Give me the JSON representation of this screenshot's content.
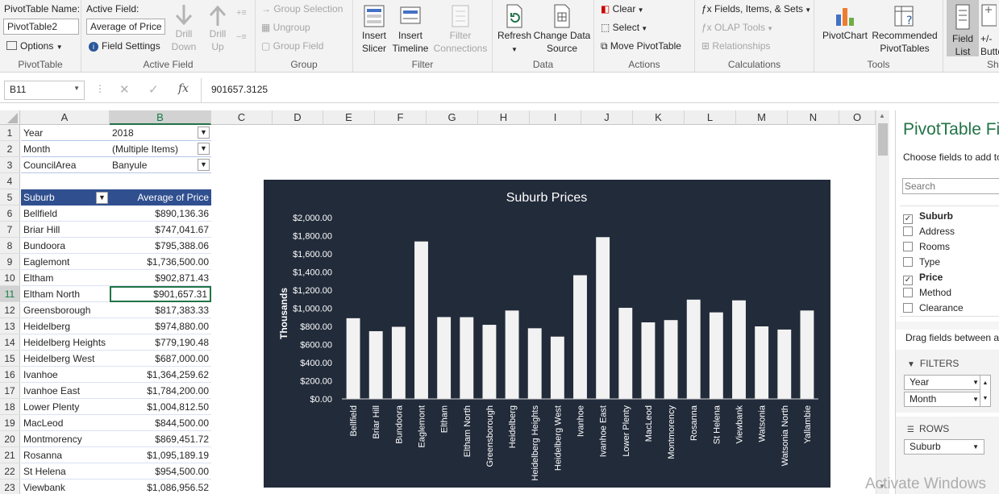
{
  "ribbon": {
    "pivottable": {
      "name_label": "PivotTable Name:",
      "name_value": "PivotTable2",
      "options": "Options",
      "group": "PivotTable"
    },
    "active_field": {
      "label": "Active Field:",
      "value": "Average of Price",
      "settings": "Field Settings",
      "drill_down": "Drill\nDown",
      "drill_up": "Drill\nUp",
      "group": "Active Field"
    },
    "group": {
      "selection": "Group Selection",
      "ungroup": "Ungroup",
      "field": "Group Field",
      "group": "Group"
    },
    "filter": {
      "slicer": "Insert\nSlicer",
      "timeline": "Insert\nTimeline",
      "connections": "Filter\nConnections",
      "group": "Filter"
    },
    "data": {
      "refresh": "Refresh",
      "change_source": "Change Data\nSource",
      "group": "Data"
    },
    "actions": {
      "clear": "Clear",
      "select": "Select",
      "move": "Move PivotTable",
      "group": "Actions"
    },
    "calculations": {
      "fields": "Fields, Items, & Sets",
      "olap": "OLAP Tools",
      "relationships": "Relationships",
      "group": "Calculations"
    },
    "tools": {
      "pivotchart": "PivotChart",
      "recommended": "Recommended\nPivotTables",
      "group": "Tools"
    },
    "show": {
      "field_list": "Field\nList",
      "buttons": "+/-\nButtons",
      "group": "Sh"
    }
  },
  "formula_bar": {
    "name_box": "B11",
    "fx": "fx",
    "value": "901657.3125"
  },
  "columns": [
    "A",
    "B",
    "C",
    "D",
    "E",
    "F",
    "G",
    "H",
    "I",
    "J",
    "K",
    "L",
    "M",
    "N",
    "O"
  ],
  "selected_column": "B",
  "rows": [
    {
      "n": "1",
      "a": "Year",
      "b": "2018",
      "filter": true
    },
    {
      "n": "2",
      "a": "Month",
      "b": "(Multiple Items)",
      "filter": true
    },
    {
      "n": "3",
      "a": "CouncilArea",
      "b": "Banyule",
      "filter": true
    },
    {
      "n": "4",
      "a": "",
      "b": ""
    },
    {
      "n": "5",
      "a": "Suburb",
      "b": "Average of Price",
      "header": true
    },
    {
      "n": "6",
      "a": "Bellfield",
      "b": "$890,136.36"
    },
    {
      "n": "7",
      "a": "Briar Hill",
      "b": "$747,041.67"
    },
    {
      "n": "8",
      "a": "Bundoora",
      "b": "$795,388.06"
    },
    {
      "n": "9",
      "a": "Eaglemont",
      "b": "$1,736,500.00"
    },
    {
      "n": "10",
      "a": "Eltham",
      "b": "$902,871.43"
    },
    {
      "n": "11",
      "a": "Eltham North",
      "b": "$901,657.31",
      "selected": true
    },
    {
      "n": "12",
      "a": "Greensborough",
      "b": "$817,383.33"
    },
    {
      "n": "13",
      "a": "Heidelberg",
      "b": "$974,880.00"
    },
    {
      "n": "14",
      "a": "Heidelberg Heights",
      "b": "$779,190.48"
    },
    {
      "n": "15",
      "a": "Heidelberg West",
      "b": "$687,000.00"
    },
    {
      "n": "16",
      "a": "Ivanhoe",
      "b": "$1,364,259.62"
    },
    {
      "n": "17",
      "a": "Ivanhoe East",
      "b": "$1,784,200.00"
    },
    {
      "n": "18",
      "a": "Lower Plenty",
      "b": "$1,004,812.50"
    },
    {
      "n": "19",
      "a": "MacLeod",
      "b": "$844,500.00"
    },
    {
      "n": "20",
      "a": "Montmorency",
      "b": "$869,451.72"
    },
    {
      "n": "21",
      "a": "Rosanna",
      "b": "$1,095,189.19"
    },
    {
      "n": "22",
      "a": "St Helena",
      "b": "$954,500.00"
    },
    {
      "n": "23",
      "a": "Viewbank",
      "b": "$1,086,956.52"
    }
  ],
  "chart_data": {
    "type": "bar",
    "title": "Suburb Prices",
    "xlabel": "",
    "ylabel": "Thousands",
    "ylim": [
      0,
      2000
    ],
    "yticks": [
      "$0.00",
      "$200.00",
      "$400.00",
      "$600.00",
      "$800.00",
      "$1,000.00",
      "$1,200.00",
      "$1,400.00",
      "$1,600.00",
      "$1,800.00",
      "$2,000.00"
    ],
    "categories": [
      "Bellfield",
      "Briar Hill",
      "Bundoora",
      "Eaglemont",
      "Eltham",
      "Eltham North",
      "Greensborough",
      "Heidelberg",
      "Heidelberg Heights",
      "Heidelberg West",
      "Ivanhoe",
      "Ivanhoe East",
      "Lower Plenty",
      "MacLeod",
      "Montmorency",
      "Rosanna",
      "St Helena",
      "Viewbank",
      "Watsonia",
      "Watsonia North",
      "Yallambie"
    ],
    "values": [
      890.14,
      747.04,
      795.39,
      1736.5,
      902.87,
      901.66,
      817.38,
      974.88,
      779.19,
      687.0,
      1364.26,
      1784.2,
      1004.81,
      844.5,
      869.45,
      1095.19,
      954.5,
      1086.96,
      800,
      765,
      975
    ],
    "grid": false,
    "legend": "none",
    "colors": {
      "background": "#222b3a",
      "bar": "#f2f2f2",
      "text": "#ffffff"
    }
  },
  "pane": {
    "title": "PivotTable Fie",
    "subtitle": "Choose fields to add to",
    "search_placeholder": "Search",
    "fields": [
      {
        "label": "Suburb",
        "checked": true
      },
      {
        "label": "Address",
        "checked": false
      },
      {
        "label": "Rooms",
        "checked": false
      },
      {
        "label": "Type",
        "checked": false
      },
      {
        "label": "Price",
        "checked": true
      },
      {
        "label": "Method",
        "checked": false
      },
      {
        "label": "Clearance",
        "checked": false
      }
    ],
    "drag_hint": "Drag fields between ar",
    "filters_label": "FILTERS",
    "filters": [
      "Year",
      "Month"
    ],
    "rows_label": "ROWS",
    "rows": [
      "Suburb"
    ]
  },
  "watermark": "Activate Windows",
  "colors": {
    "excel_green": "#217346",
    "header_blue": "#2f4f8f"
  }
}
